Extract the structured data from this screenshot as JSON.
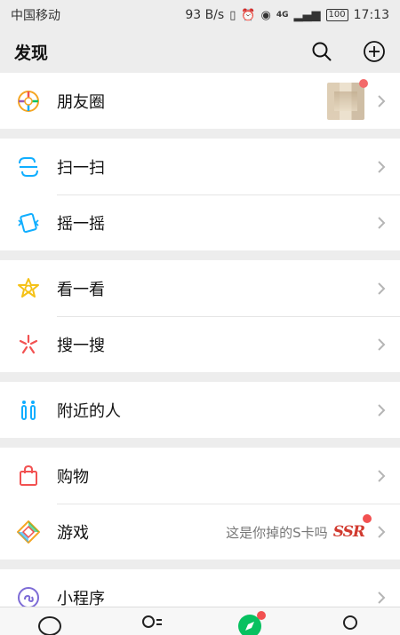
{
  "status_bar": {
    "carrier": "中国移动",
    "speed": "93 B/s",
    "network": "4G",
    "battery": "100",
    "time": "17:13"
  },
  "header": {
    "title": "发现",
    "search_icon": "search-icon",
    "add_icon": "plus-circle-icon"
  },
  "sections": [
    {
      "items": [
        {
          "label": "朋友圈",
          "icon": "moments-icon"
        }
      ]
    },
    {
      "items": [
        {
          "label": "扫一扫",
          "icon": "scan-icon"
        },
        {
          "label": "摇一摇",
          "icon": "shake-icon"
        }
      ]
    },
    {
      "items": [
        {
          "label": "看一看",
          "icon": "top-stories-icon"
        },
        {
          "label": "搜一搜",
          "icon": "search-spark-icon"
        }
      ]
    },
    {
      "items": [
        {
          "label": "附近的人",
          "icon": "people-nearby-icon"
        }
      ]
    },
    {
      "items": [
        {
          "label": "购物",
          "icon": "shopping-bag-icon"
        },
        {
          "label": "游戏",
          "icon": "games-icon",
          "extra": "这是你掉的S卡吗",
          "badge": "SSR"
        }
      ]
    },
    {
      "items": [
        {
          "label": "小程序",
          "icon": "mini-programs-icon"
        }
      ]
    }
  ],
  "colors": {
    "background": "#ededed",
    "accent_green": "#07c160",
    "red_dot": "#f25151"
  }
}
